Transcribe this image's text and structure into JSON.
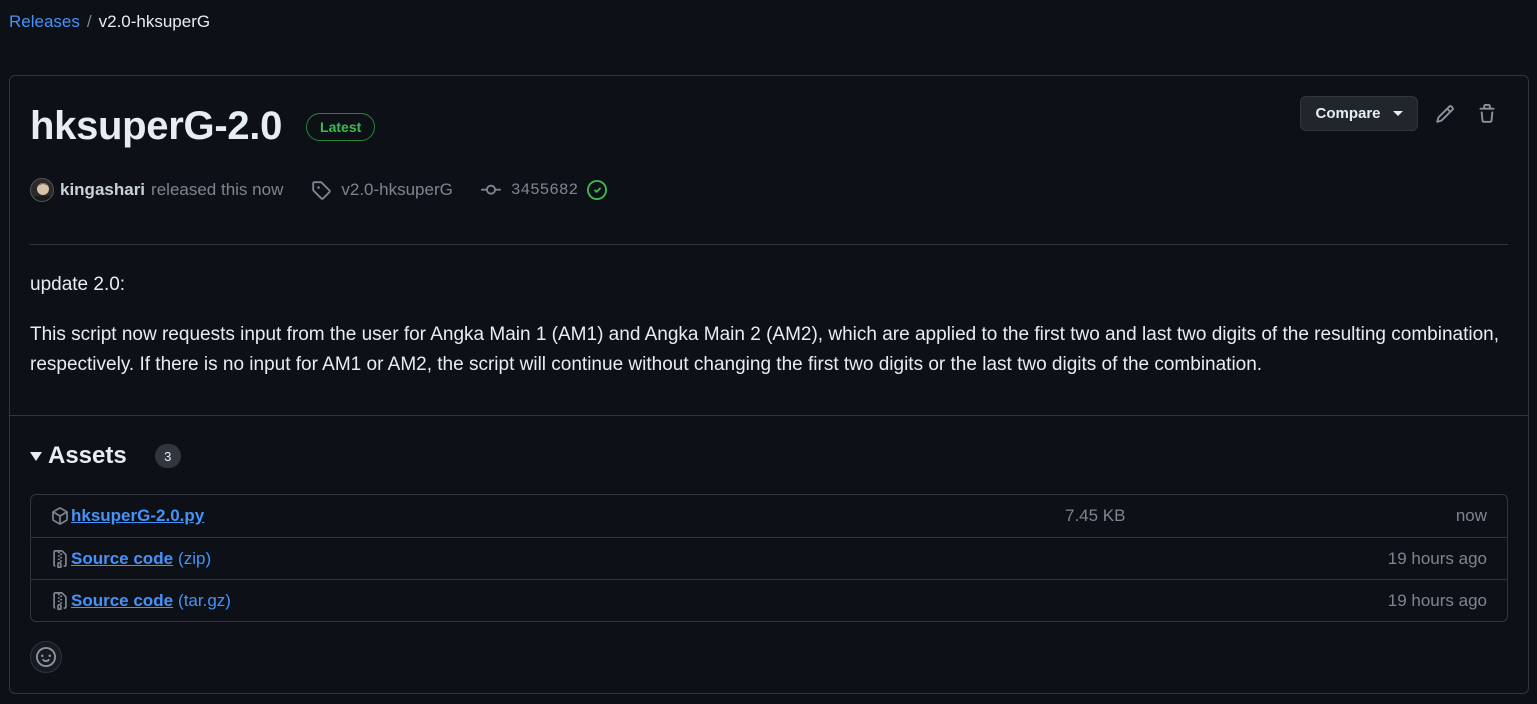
{
  "breadcrumb": {
    "releases": "Releases",
    "separator": "/",
    "current": "v2.0-hksuperG"
  },
  "release": {
    "title": "hksuperG-2.0",
    "badge": "Latest",
    "compare_label": "Compare",
    "author": "kingashari",
    "released_text": "released this now",
    "tag": "v2.0-hksuperG",
    "commit": "3455682",
    "body": {
      "heading": "update 2.0:",
      "paragraph": "This script now requests input from the user for Angka Main 1 (AM1) and Angka Main 2 (AM2), which are applied to the first two and last two digits of the resulting combination, respectively. If there is no input for AM1 or AM2, the script will continue without changing the first two digits or the last two digits of the combination."
    }
  },
  "assets": {
    "title": "Assets",
    "count": "3",
    "items": [
      {
        "name": "hksuperG-2.0.py",
        "suffix": "",
        "size": "7.45 KB",
        "time": "now",
        "icon": "package-icon"
      },
      {
        "name": "Source code",
        "suffix": "(zip)",
        "size": "",
        "time": "19 hours ago",
        "icon": "file-zip-icon"
      },
      {
        "name": "Source code",
        "suffix": "(tar.gz)",
        "size": "",
        "time": "19 hours ago",
        "icon": "file-zip-icon"
      }
    ]
  },
  "colors": {
    "background": "#0d1117",
    "border": "#30363d",
    "link": "#4493f8",
    "muted": "#7d8590",
    "success": "#3fb950"
  }
}
